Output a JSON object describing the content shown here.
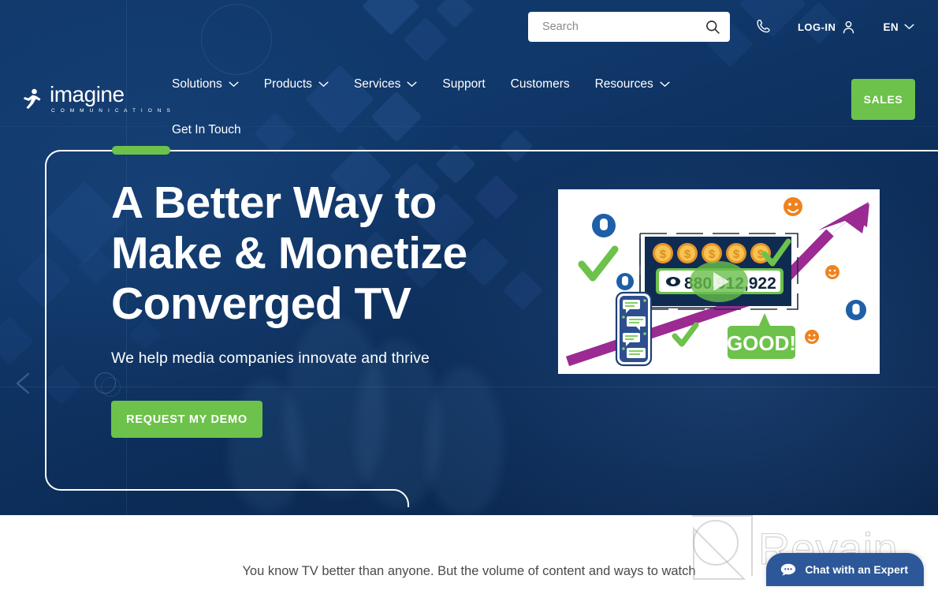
{
  "brand": {
    "logo_word": "imagine",
    "logo_sub": "C O M M U N I C A T I O N S",
    "accent_green": "#6cc24a",
    "navy": "#0c2c57",
    "chat_blue": "#2c5899"
  },
  "utility": {
    "search_placeholder": "Search",
    "search_value": "",
    "phone_icon": "phone-icon",
    "login_label": "LOG-IN",
    "user_icon": "user-icon",
    "language": "EN",
    "chevron_icon": "chevron-down-icon"
  },
  "nav": {
    "items": [
      {
        "label": "Solutions",
        "has_dropdown": true
      },
      {
        "label": "Products",
        "has_dropdown": true
      },
      {
        "label": "Services",
        "has_dropdown": true
      },
      {
        "label": "Support",
        "has_dropdown": false
      },
      {
        "label": "Customers",
        "has_dropdown": false
      },
      {
        "label": "Resources",
        "has_dropdown": true
      },
      {
        "label": "Get In Touch",
        "has_dropdown": false
      }
    ],
    "sales_label": "SALES"
  },
  "hero": {
    "title_line1": "A Better Way to",
    "title_line2": "Make & Monetize",
    "title_line3": "Converged TV",
    "subtitle": "We help media companies innovate and thrive",
    "cta_label": "REQUEST MY DEMO"
  },
  "video": {
    "view_count": "880,912,922",
    "good_label": "GOOD!",
    "eye_icon": "eye-icon",
    "play_icon": "play-icon",
    "coin_count": 5,
    "coin_symbol": "$"
  },
  "carousel": {
    "prev_icon": "chevron-left-icon",
    "dot_icon": "carousel-dot-icon"
  },
  "lower": {
    "paragraph": "You know TV better than anyone. But the volume of content and ways to watch"
  },
  "watermark": {
    "label": "Revain"
  },
  "chat": {
    "label": "Chat with an Expert",
    "icon": "chat-bubble-icon"
  }
}
